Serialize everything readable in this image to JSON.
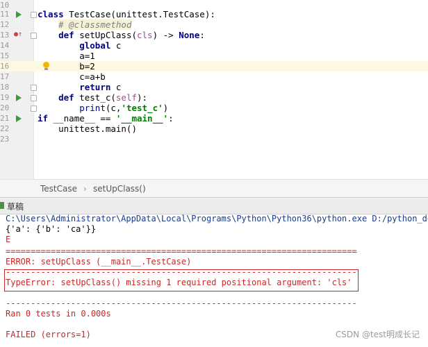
{
  "editor": {
    "lines": [
      {
        "num": "10",
        "text": ""
      },
      {
        "num": "11",
        "text": "class TestCase(unittest.TestCase):"
      },
      {
        "num": "12",
        "text": "    # @classmethod"
      },
      {
        "num": "13",
        "text": "    def setUpClass(cls) -> None:"
      },
      {
        "num": "14",
        "text": "        global c"
      },
      {
        "num": "15",
        "text": "        a=1"
      },
      {
        "num": "16",
        "text": "        b=2"
      },
      {
        "num": "17",
        "text": "        c=a+b"
      },
      {
        "num": "18",
        "text": "        return c"
      },
      {
        "num": "19",
        "text": "    def test_c(self):"
      },
      {
        "num": "20",
        "text": "        print(c,'test_c')"
      },
      {
        "num": "21",
        "text": "if __name__ == '__main__':"
      },
      {
        "num": "22",
        "text": "    unittest.main()"
      },
      {
        "num": "23",
        "text": ""
      }
    ]
  },
  "breadcrumb": {
    "item1": "TestCase",
    "separator": "›",
    "item2": "setUpClass()"
  },
  "run_panel": {
    "tab_label": "草稿",
    "output": [
      "C:\\Users\\Administrator\\AppData\\Local\\Programs\\Python\\Python36\\python.exe D:/python_doc/",
      "{'a': {'b': 'ca'}}",
      "E",
      "======================================================================",
      "ERROR: setUpClass (__main__.TestCase)",
      "----------------------------------------------------------------------",
      "TypeError: setUpClass() missing 1 required positional argument: 'cls'",
      "",
      "----------------------------------------------------------------------",
      "Ran 0 tests in 0.000s",
      "",
      "FAILED (errors=1)"
    ]
  },
  "watermark": "CSDN @test明成长记",
  "colors": {
    "keyword": "#000080",
    "string": "#008000",
    "comment": "#808080",
    "error_box": "#cc2222",
    "highlight_line": "#fcf9e3"
  },
  "icons": [
    "run-arrow-icon",
    "fold-marker-icon",
    "lightbulb-icon",
    "override-icon"
  ]
}
